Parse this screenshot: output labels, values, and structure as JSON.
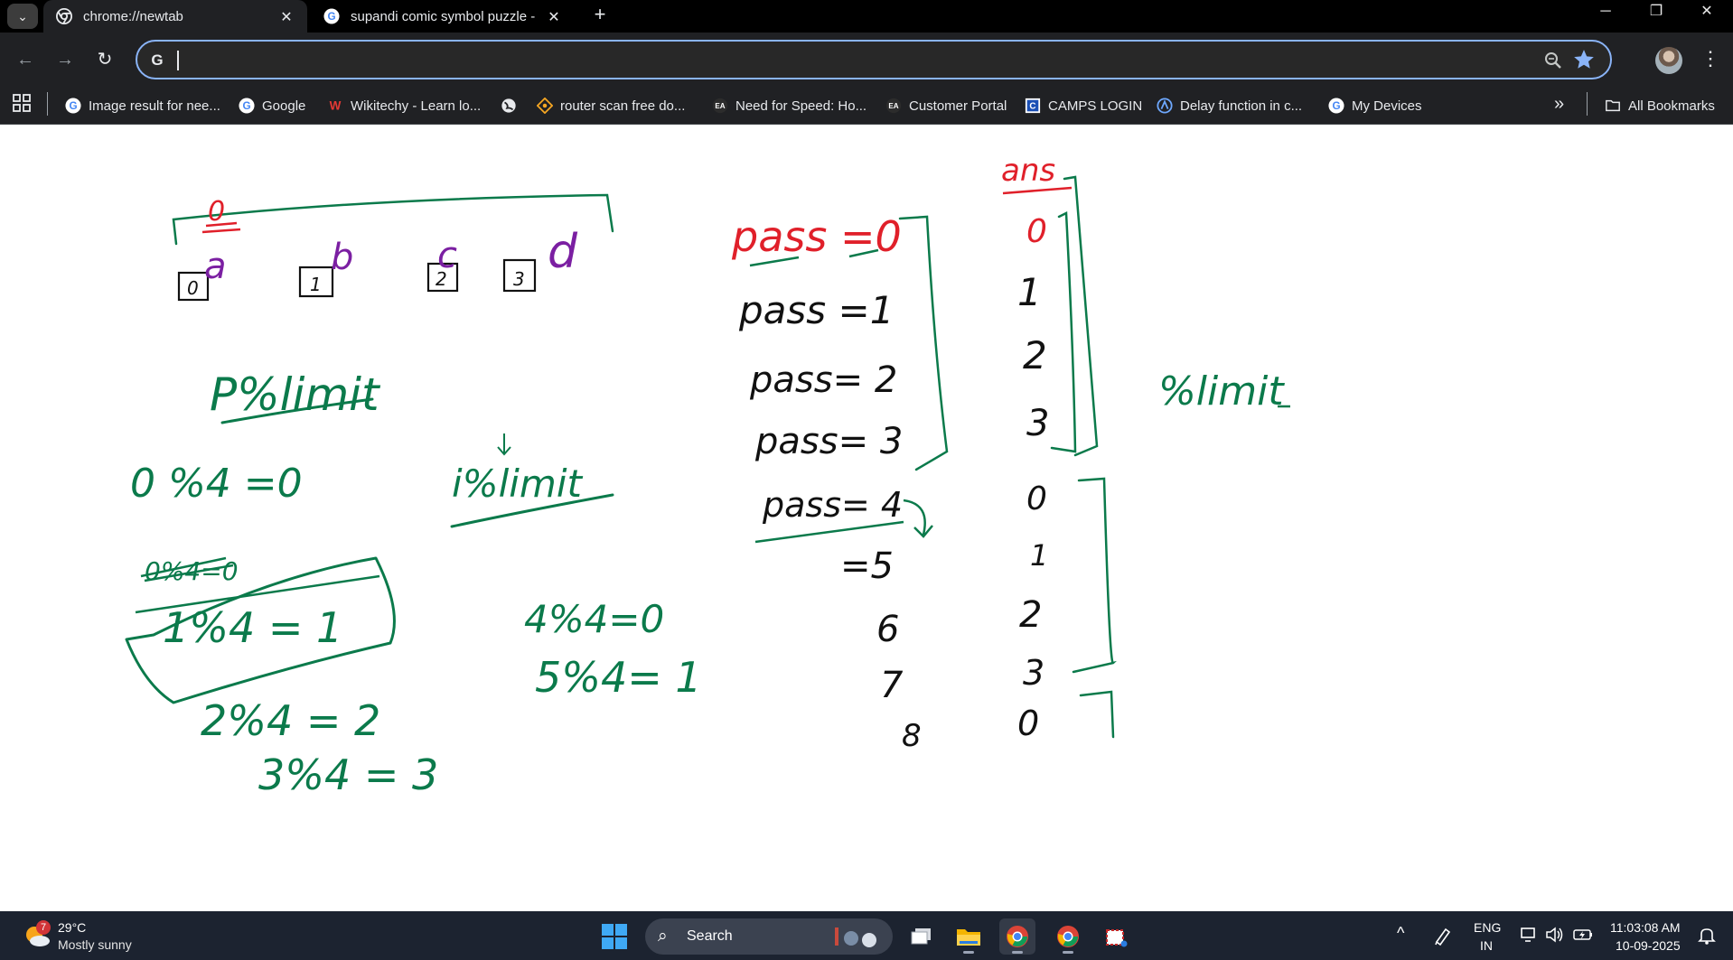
{
  "browser": {
    "tabs": [
      {
        "title": "chrome://newtab",
        "icon": "chrome-icon",
        "active": true
      },
      {
        "title": "supandi comic symbol puzzle -",
        "icon": "google-icon",
        "active": false
      }
    ],
    "new_tab_symbol": "+",
    "tab_search_symbol": "⌄",
    "close_symbol": "✕",
    "window_controls": {
      "minimize": "─",
      "restore": "❐",
      "close": "✕"
    },
    "nav": {
      "back": "←",
      "forward": "→",
      "reload": "↻"
    },
    "omnibox": {
      "value": "",
      "placeholder": ""
    },
    "menu_symbol": "⋮",
    "bookmarks": [
      {
        "label": "Image result for nee...",
        "icon": "google-icon"
      },
      {
        "label": "Google",
        "icon": "google-icon"
      },
      {
        "label": "Wikitechy - Learn lo...",
        "icon": "wikitechy-icon"
      },
      {
        "label": "",
        "icon": "globe-icon"
      },
      {
        "label": "router scan free do...",
        "icon": "diamond-icon"
      },
      {
        "label": "Need for Speed: Ho...",
        "icon": "ea-icon"
      },
      {
        "label": "Customer Portal",
        "icon": "ea-icon"
      },
      {
        "label": "CAMPS LOGIN",
        "icon": "camps-icon"
      },
      {
        "label": "Delay function in c...",
        "icon": "delay-icon"
      },
      {
        "label": "My Devices",
        "icon": "google-icon"
      }
    ],
    "overflow_symbol": "»",
    "all_bookmarks": "All Bookmarks",
    "colors": {
      "accent": "#8ab4f8",
      "frame": "#202124",
      "tabstrip": "#000000"
    }
  },
  "whiteboard": {
    "ink_green": "#0b7a4b",
    "ink_red": "#e0202a",
    "ink_purple": "#7b1fa2",
    "ink_black": "#111111",
    "labels": {
      "top_zero": "0",
      "box_letters": [
        "a",
        "b",
        "c",
        "d"
      ],
      "box_indices": [
        "0",
        "1",
        "2",
        "3"
      ],
      "p_mod_limit": "P%limit",
      "zero_mod": "0 %4 =0",
      "i_mod_limit": "i%limit",
      "strike_line": "0%4=0",
      "one_mod": "1%4 = 1",
      "two_mod": "2%4 = 2",
      "three_mod": "3%4 = 3",
      "four_mod": "4%4=0",
      "five_mod": "5%4= 1",
      "pass0": "pass =0",
      "pass1": "pass =1",
      "pass2": "pass= 2",
      "pass3": "pass= 3",
      "pass4": "pass= 4",
      "eq5": "=5",
      "n6": "6",
      "n7": "7",
      "n8": "8",
      "ans_title": "ans",
      "ans_values": [
        "0",
        "1",
        "2",
        "3",
        "0",
        "1",
        "2",
        "3",
        "0"
      ],
      "mod_limit_right": "%limit"
    }
  },
  "taskbar": {
    "weather": {
      "badge": "7",
      "temp": "29°C",
      "desc": "Mostly sunny"
    },
    "search_label": "Search",
    "tray": {
      "chevron": "^",
      "lang_line1": "ENG",
      "lang_line2": "IN",
      "time": "11:03:08 AM",
      "date": "10-09-2025"
    }
  }
}
